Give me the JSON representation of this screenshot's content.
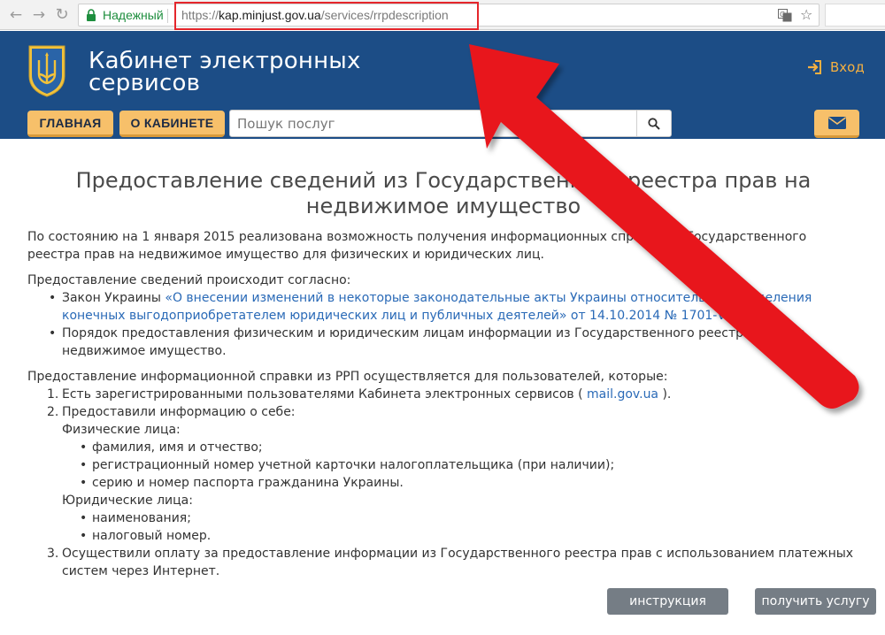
{
  "browser": {
    "secure_label": "Надежный",
    "url_scheme": "https://",
    "url_host": "kap.minjust.gov.ua",
    "url_path": "/services/rrpdescription",
    "icons": [
      "back-icon",
      "forward-icon",
      "reload-icon",
      "lock-icon",
      "translate-icon",
      "star-icon"
    ]
  },
  "header": {
    "title_line1": "Кабинет электронных",
    "title_line2": "сервисов",
    "login_label": "Вход",
    "logo": "ukraine-trident-emblem"
  },
  "nav": {
    "home": "ГЛАВНАЯ",
    "about": "О КАБИНЕТЕ",
    "search_placeholder": "Пошук послуг"
  },
  "content": {
    "title": "Предоставление сведений из Государственного реестра прав на недвижимое имущество",
    "intro": "По состоянию на 1 января 2015 реализована возможность получения информационных справок из Государственного реестра прав на недвижимое имущество для физических и юридических лиц.",
    "basis_heading": "Предоставление сведений происходит согласно:",
    "basis_items": [
      {
        "prefix": "Закон Украины ",
        "link": "«О внесении изменений в некоторые законодательные акты Украины относительно определения конечных выгодоприобретателем юридических лиц и публичных деятелей» от 14.10.2014 № 1701-VII"
      },
      {
        "text": "Порядок предоставления физическим и юридическим лицам информации из Государственного реестра прав на недвижимое имущество."
      }
    ],
    "users_heading": "Предоставление информационной справки из РРП осуществляется для пользователей, которые:",
    "steps": [
      {
        "num": "1.",
        "text_before": "Есть зарегистрированными пользователями Кабинета электронных сервисов ( ",
        "link": "mail.gov.ua",
        "text_after": " )."
      },
      {
        "num": "2.",
        "text": "Предоставили информацию о себе:",
        "individuals_label": "Физические лица:",
        "individuals": [
          "фамилия, имя и отчество;",
          "регистрационный номер учетной карточки налогоплательщика (при наличии);",
          "серию и номер паспорта гражданина Украины."
        ],
        "legal_label": "Юридические лица:",
        "legal": [
          "наименования;",
          "налоговый номер."
        ]
      },
      {
        "num": "3.",
        "text": "Осуществили оплату за предоставление информации из Государственного реестра прав с использованием платежных систем через Интернет."
      }
    ]
  },
  "actions": {
    "instruction": "инструкция",
    "get_service": "получить услугу"
  },
  "colors": {
    "header_bg": "#1c4d86",
    "nav_button": "#f7c06a",
    "link": "#2a6ab7",
    "annotation_red": "#e8141e",
    "secure_green": "#1e8e3e",
    "action_button": "#757d85"
  }
}
